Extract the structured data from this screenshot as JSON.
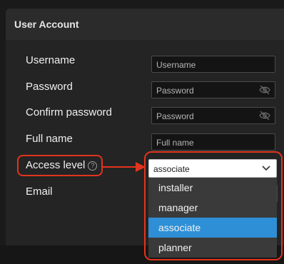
{
  "panel": {
    "title": "User Account"
  },
  "fields": {
    "username": {
      "label": "Username",
      "placeholder": "Username"
    },
    "password": {
      "label": "Password",
      "placeholder": "Password"
    },
    "confirm_password": {
      "label": "Confirm password",
      "placeholder": "Password"
    },
    "full_name": {
      "label": "Full name",
      "placeholder": "Full name"
    },
    "access_level": {
      "label": "Access level",
      "help_glyph": "?",
      "value": "associate"
    },
    "email": {
      "label": "Email"
    }
  },
  "access_level_options": [
    {
      "label": "installer",
      "selected": false
    },
    {
      "label": "manager",
      "selected": false
    },
    {
      "label": "associate",
      "selected": true
    },
    {
      "label": "planner",
      "selected": false
    }
  ],
  "colors": {
    "accent": "#2e8fd6",
    "callout": "#e2341d",
    "panel_bg": "#242424",
    "input_bg": "#141414"
  },
  "icons": {
    "password_toggle": "eye-slash-icon",
    "dropdown": "chevron-down-icon",
    "help": "help-circle-icon",
    "callout_arrow": "arrow-right-icon"
  }
}
